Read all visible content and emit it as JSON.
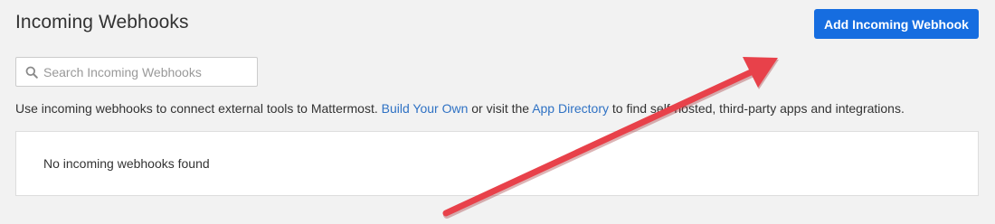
{
  "header": {
    "title": "Incoming Webhooks",
    "add_button_label": "Add Incoming Webhook"
  },
  "search": {
    "placeholder": "Search Incoming Webhooks",
    "value": "",
    "icon": "search-icon"
  },
  "description": {
    "text_before": "Use incoming webhooks to connect external tools to Mattermost. ",
    "link_build": "Build Your Own",
    "text_middle": " or visit the ",
    "link_directory": "App Directory",
    "text_after": " to find self-hosted, third-party apps and integrations."
  },
  "list": {
    "empty_message": "No incoming webhooks found"
  },
  "colors": {
    "primary_button": "#166de0",
    "link": "#2f72c4",
    "annotation_arrow": "#e8414a",
    "background": "#f2f2f2"
  }
}
